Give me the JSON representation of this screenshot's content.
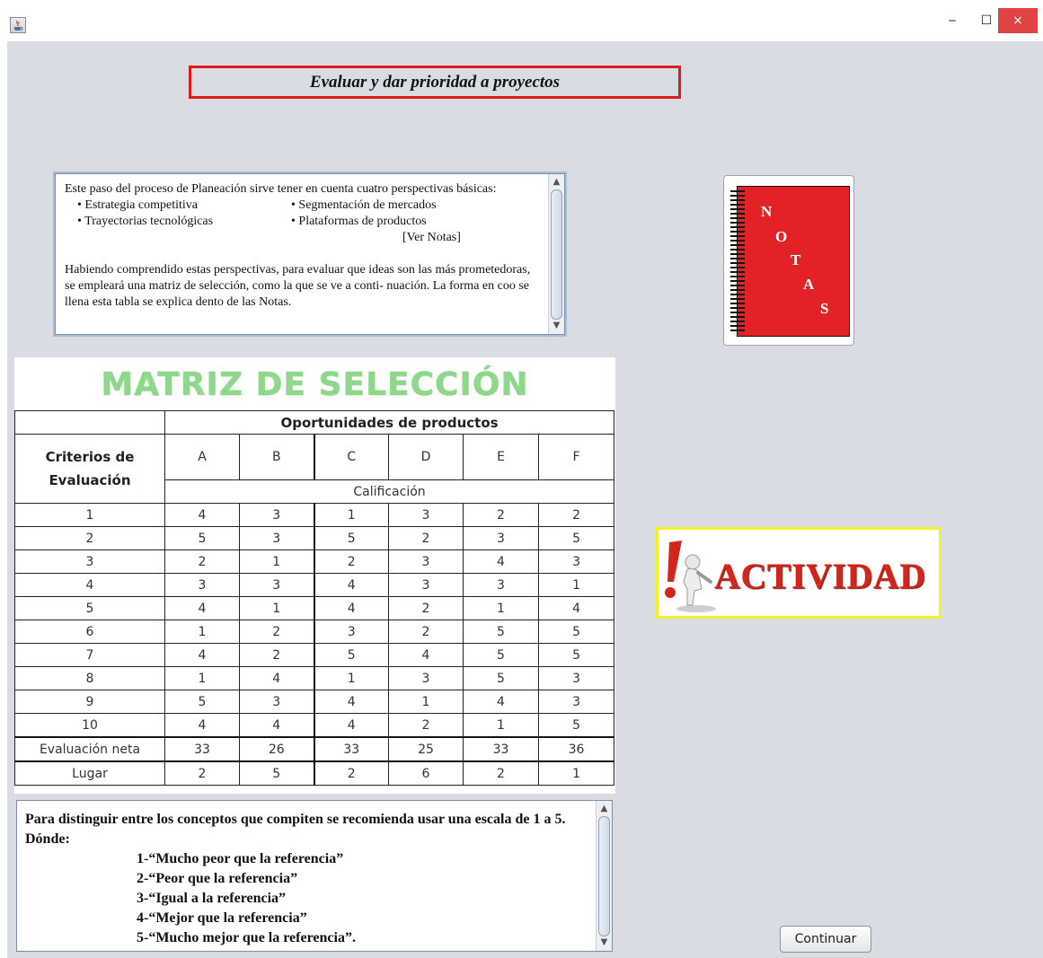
{
  "window": {
    "app_icon": "java-cup-icon",
    "minimize_glyph": "‒",
    "maximize_glyph": "☐",
    "close_glyph": "×"
  },
  "header": {
    "title": "Evaluar y dar prioridad a proyectos"
  },
  "intro_text": {
    "line1": "Este paso del proceso de Planeación sirve tener en cuenta cuatro perspectivas básicas:",
    "bullets_left": [
      "• Estrategia competitiva",
      "• Trayectorias tecnológicas"
    ],
    "bullets_right": [
      "• Segmentación de mercados",
      "• Plataformas de productos"
    ],
    "link": "[Ver Notas]",
    "paragraph2": "Habiendo comprendido estas perspectivas, para evaluar que ideas son las más prometedoras, se empleará una matriz de selección, como la que se ve a conti- nuación. La forma en coo se llena esta tabla se explica dento de las Notas."
  },
  "notas_button": {
    "letters": [
      "N",
      "O",
      "T",
      "A",
      "S"
    ],
    "color": "#e32227"
  },
  "matrix": {
    "title": "MATRIZ DE SELECCIÓN",
    "criteria_header": "Criterios de Evaluación",
    "opportunities_header": "Oportunidades de productos",
    "columns": [
      "A",
      "B",
      "C",
      "D",
      "E",
      "F"
    ],
    "rating_header": "Calificación",
    "rows": [
      {
        "label": "1",
        "values": [
          "4",
          "3",
          "1",
          "3",
          "2",
          "2"
        ]
      },
      {
        "label": "2",
        "values": [
          "5",
          "3",
          "5",
          "2",
          "3",
          "5"
        ]
      },
      {
        "label": "3",
        "values": [
          "2",
          "1",
          "2",
          "3",
          "4",
          "3"
        ]
      },
      {
        "label": "4",
        "values": [
          "3",
          "3",
          "4",
          "3",
          "3",
          "1"
        ]
      },
      {
        "label": "5",
        "values": [
          "4",
          "1",
          "4",
          "2",
          "1",
          "4"
        ]
      },
      {
        "label": "6",
        "values": [
          "1",
          "2",
          "3",
          "2",
          "5",
          "5"
        ]
      },
      {
        "label": "7",
        "values": [
          "4",
          "2",
          "5",
          "4",
          "5",
          "5"
        ]
      },
      {
        "label": "8",
        "values": [
          "1",
          "4",
          "1",
          "3",
          "5",
          "3"
        ]
      },
      {
        "label": "9",
        "values": [
          "5",
          "3",
          "4",
          "1",
          "4",
          "3"
        ]
      },
      {
        "label": "10",
        "values": [
          "4",
          "4",
          "4",
          "2",
          "1",
          "5"
        ]
      }
    ],
    "net_label": "Evaluación neta",
    "net_values": [
      "33",
      "26",
      "33",
      "25",
      "33",
      "36"
    ],
    "rank_label": "Lugar",
    "rank_values": [
      "2",
      "5",
      "2",
      "6",
      "2",
      "1"
    ],
    "title_color": "#8ed88a"
  },
  "actividad": {
    "label": "ACTIVIDAD",
    "border_color": "#f1f02a",
    "text_color": "#d3251b"
  },
  "scale_text": {
    "intro": "Para distinguir entre los conceptos que compiten se recomienda usar una escala de 1 a 5. Dónde:",
    "items": [
      "1-“Mucho peor que la referencia”",
      "2-“Peor que la referencia”",
      "3-“Igual a la referencia”",
      "4-“Mejor que la referencia”",
      "5-“Mucho mejor que la referencia”."
    ]
  },
  "continue_button": {
    "label": "Continuar"
  }
}
